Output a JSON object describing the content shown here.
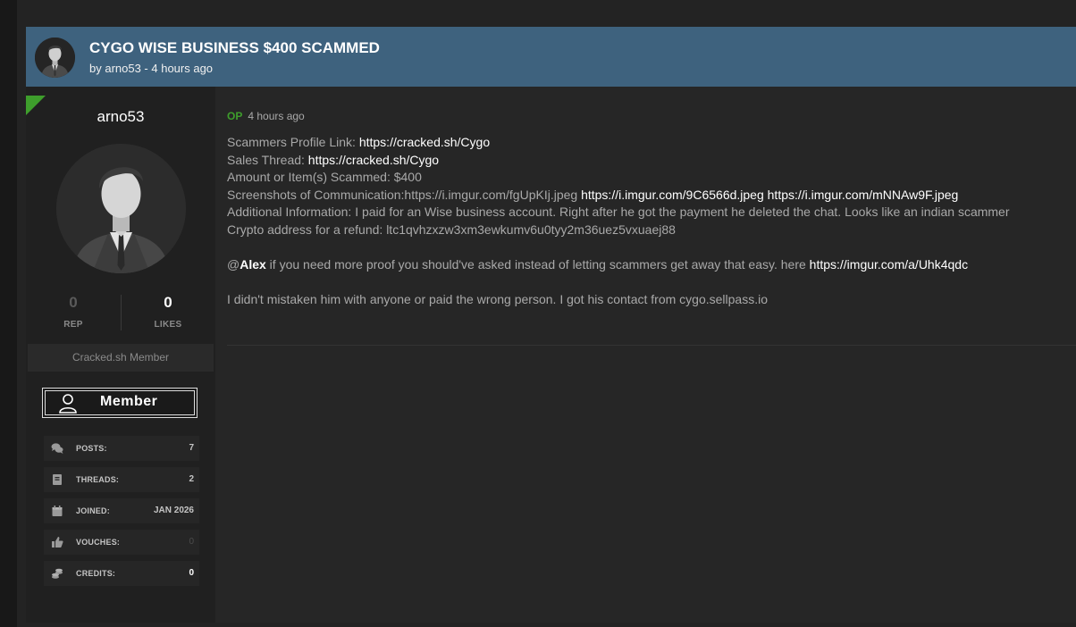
{
  "thread": {
    "title": "CYGO WISE BUSINESS $400 SCAMMED",
    "meta": "by arno53 - 4 hours ago"
  },
  "author": {
    "username": "arno53",
    "rep_value": "0",
    "rep_label": "REP",
    "likes_value": "0",
    "likes_label": "LIKES",
    "usertitle": "Cracked.sh Member",
    "badge_label": "Member",
    "info": [
      {
        "icon": "comments-icon",
        "key": "POSTS:",
        "value": "7"
      },
      {
        "icon": "book-icon",
        "key": "THREADS:",
        "value": "2"
      },
      {
        "icon": "calendar-icon",
        "key": "JOINED:",
        "value": "JAN 2026"
      },
      {
        "icon": "thumbs-up-icon",
        "key": "VOUCHES:",
        "value": "0"
      },
      {
        "icon": "coins-icon",
        "key": "CREDITS:",
        "value": "0"
      }
    ]
  },
  "post": {
    "op_label": "OP",
    "time": "4 hours ago",
    "line1_label": "Scammers Profile Link: ",
    "line1_link": "https://cracked.sh/Cygo",
    "line2_label": "Sales Thread: ",
    "line2_link": "https://cracked.sh/Cygo",
    "line3": "Amount or Item(s) Scammed: $400",
    "line4_label": "Screenshots of Communication:https://i.imgur.com/fgUpKIj.jpeg ",
    "line4_link1": "https://i.imgur.com/9C6566d.jpeg",
    "line4_link2": "https://i.imgur.com/mNNAw9F.jpeg",
    "line5": "Additional Information: I paid for an Wise business account. Right after he got the payment he deleted the chat. Looks like an indian scammer",
    "line6": "Crypto address for a refund: ltc1qvhzxzw3xm3ewkumv6u0tyy2m36uez5vxuaej88",
    "mention_at": "@",
    "mention_name": "Alex",
    "line7_text": " if you need more proof you should've asked instead of letting scammers get away that easy. here ",
    "line7_link": "https://imgur.com/a/Uhk4qdc",
    "line8": "I didn't mistaken him with anyone or paid the wrong person. I got his contact from cygo.sellpass.io"
  },
  "colors": {
    "header_bg": "#3e627e",
    "op_green": "#3e9e2c",
    "mention_orange": "#e8742b"
  }
}
